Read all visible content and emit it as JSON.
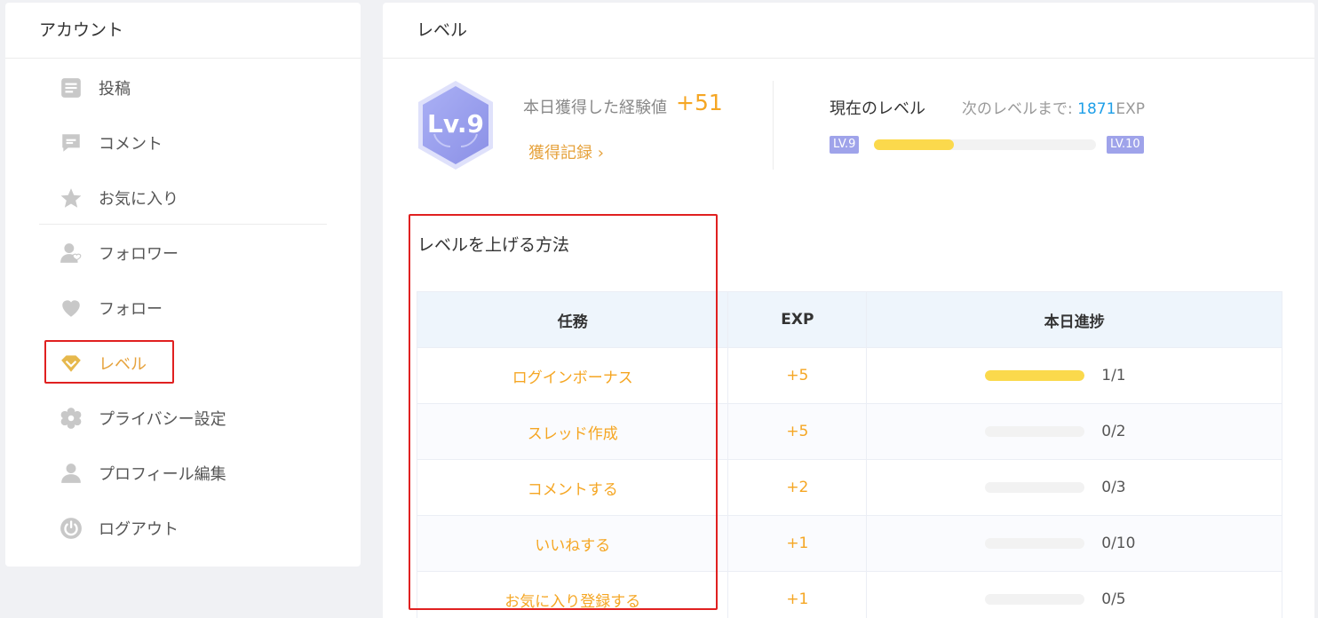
{
  "sidebar": {
    "title": "アカウント",
    "items": [
      {
        "label": "投稿",
        "icon": "document-icon"
      },
      {
        "label": "コメント",
        "icon": "comment-icon"
      },
      {
        "label": "お気に入り",
        "icon": "star-icon"
      },
      {
        "label": "フォロワー",
        "icon": "follower-icon"
      },
      {
        "label": "フォロー",
        "icon": "heart-icon"
      },
      {
        "label": "レベル",
        "icon": "diamond-icon",
        "active": true
      },
      {
        "label": "プライバシー設定",
        "icon": "gear-icon"
      },
      {
        "label": "プロフィール編集",
        "icon": "user-icon"
      },
      {
        "label": "ログアウト",
        "icon": "power-icon"
      }
    ]
  },
  "main": {
    "title": "レベル",
    "badge": "Lv.9",
    "exp_label": "本日獲得した経験値",
    "exp_gain": "+51",
    "history_link": "獲得記録",
    "current_level_label": "現在のレベル",
    "next_level_prefix": "次のレベルまで:",
    "next_level_value": "1871",
    "next_level_unit": "EXP",
    "level_from": "LV.9",
    "level_to": "LV.10",
    "level_progress": 0.36,
    "section_title": "レベルを上げる方法",
    "table": {
      "headers": [
        "任務",
        "EXP",
        "本日進捗"
      ],
      "rows": [
        {
          "task": "ログインボーナス",
          "exp": "+5",
          "progress": "1/1",
          "ratio": 1
        },
        {
          "task": "スレッド作成",
          "exp": "+5",
          "progress": "0/2",
          "ratio": 0
        },
        {
          "task": "コメントする",
          "exp": "+2",
          "progress": "0/3",
          "ratio": 0
        },
        {
          "task": "いいねする",
          "exp": "+1",
          "progress": "0/10",
          "ratio": 0
        },
        {
          "task": "お気に入り登録する",
          "exp": "+1",
          "progress": "0/5",
          "ratio": 0
        }
      ]
    }
  },
  "colors": {
    "accent": "#e6a23c",
    "badge": "#9fa3ea",
    "progress": "#fbd94c",
    "link": "#1e9fe8",
    "highlight": "#e02020"
  }
}
